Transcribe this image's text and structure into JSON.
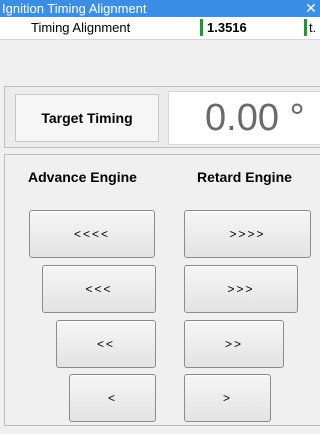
{
  "window": {
    "title": "Ignition Timing Alignment",
    "close_glyph": "✕"
  },
  "status": {
    "label": "Timing Alignment",
    "value": "1.3516",
    "truncated_text": "t."
  },
  "target": {
    "label": "Target Timing",
    "value": "0.00 °"
  },
  "advance": {
    "heading": "Advance Engine",
    "buttons": [
      "<<<<",
      "<<<",
      "<<",
      "<"
    ]
  },
  "retard": {
    "heading": "Retard Engine",
    "buttons": [
      ">>>>",
      ">>>",
      ">>",
      ">"
    ]
  },
  "colors": {
    "titlebar": "#3a8ee6",
    "indicator": "#1a9b2e"
  }
}
